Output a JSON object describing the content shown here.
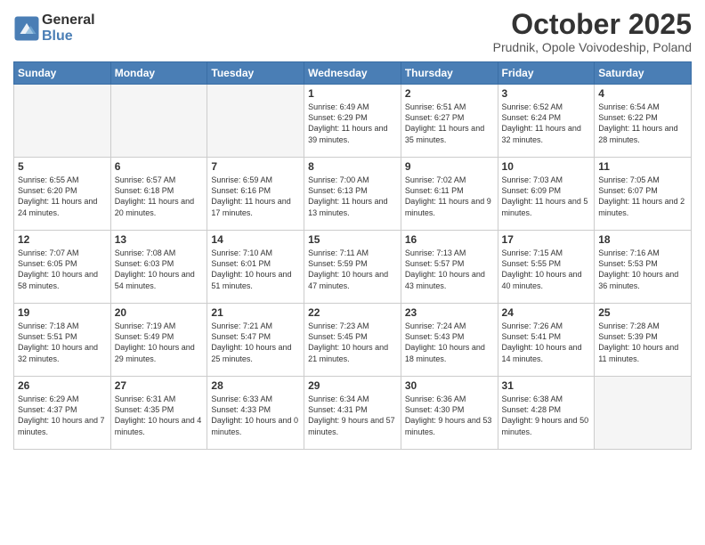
{
  "header": {
    "logo_general": "General",
    "logo_blue": "Blue",
    "month": "October 2025",
    "location": "Prudnik, Opole Voivodeship, Poland"
  },
  "weekdays": [
    "Sunday",
    "Monday",
    "Tuesday",
    "Wednesday",
    "Thursday",
    "Friday",
    "Saturday"
  ],
  "weeks": [
    [
      {
        "day": "",
        "info": ""
      },
      {
        "day": "",
        "info": ""
      },
      {
        "day": "",
        "info": ""
      },
      {
        "day": "1",
        "info": "Sunrise: 6:49 AM\nSunset: 6:29 PM\nDaylight: 11 hours\nand 39 minutes."
      },
      {
        "day": "2",
        "info": "Sunrise: 6:51 AM\nSunset: 6:27 PM\nDaylight: 11 hours\nand 35 minutes."
      },
      {
        "day": "3",
        "info": "Sunrise: 6:52 AM\nSunset: 6:24 PM\nDaylight: 11 hours\nand 32 minutes."
      },
      {
        "day": "4",
        "info": "Sunrise: 6:54 AM\nSunset: 6:22 PM\nDaylight: 11 hours\nand 28 minutes."
      }
    ],
    [
      {
        "day": "5",
        "info": "Sunrise: 6:55 AM\nSunset: 6:20 PM\nDaylight: 11 hours\nand 24 minutes."
      },
      {
        "day": "6",
        "info": "Sunrise: 6:57 AM\nSunset: 6:18 PM\nDaylight: 11 hours\nand 20 minutes."
      },
      {
        "day": "7",
        "info": "Sunrise: 6:59 AM\nSunset: 6:16 PM\nDaylight: 11 hours\nand 17 minutes."
      },
      {
        "day": "8",
        "info": "Sunrise: 7:00 AM\nSunset: 6:13 PM\nDaylight: 11 hours\nand 13 minutes."
      },
      {
        "day": "9",
        "info": "Sunrise: 7:02 AM\nSunset: 6:11 PM\nDaylight: 11 hours\nand 9 minutes."
      },
      {
        "day": "10",
        "info": "Sunrise: 7:03 AM\nSunset: 6:09 PM\nDaylight: 11 hours\nand 5 minutes."
      },
      {
        "day": "11",
        "info": "Sunrise: 7:05 AM\nSunset: 6:07 PM\nDaylight: 11 hours\nand 2 minutes."
      }
    ],
    [
      {
        "day": "12",
        "info": "Sunrise: 7:07 AM\nSunset: 6:05 PM\nDaylight: 10 hours\nand 58 minutes."
      },
      {
        "day": "13",
        "info": "Sunrise: 7:08 AM\nSunset: 6:03 PM\nDaylight: 10 hours\nand 54 minutes."
      },
      {
        "day": "14",
        "info": "Sunrise: 7:10 AM\nSunset: 6:01 PM\nDaylight: 10 hours\nand 51 minutes."
      },
      {
        "day": "15",
        "info": "Sunrise: 7:11 AM\nSunset: 5:59 PM\nDaylight: 10 hours\nand 47 minutes."
      },
      {
        "day": "16",
        "info": "Sunrise: 7:13 AM\nSunset: 5:57 PM\nDaylight: 10 hours\nand 43 minutes."
      },
      {
        "day": "17",
        "info": "Sunrise: 7:15 AM\nSunset: 5:55 PM\nDaylight: 10 hours\nand 40 minutes."
      },
      {
        "day": "18",
        "info": "Sunrise: 7:16 AM\nSunset: 5:53 PM\nDaylight: 10 hours\nand 36 minutes."
      }
    ],
    [
      {
        "day": "19",
        "info": "Sunrise: 7:18 AM\nSunset: 5:51 PM\nDaylight: 10 hours\nand 32 minutes."
      },
      {
        "day": "20",
        "info": "Sunrise: 7:19 AM\nSunset: 5:49 PM\nDaylight: 10 hours\nand 29 minutes."
      },
      {
        "day": "21",
        "info": "Sunrise: 7:21 AM\nSunset: 5:47 PM\nDaylight: 10 hours\nand 25 minutes."
      },
      {
        "day": "22",
        "info": "Sunrise: 7:23 AM\nSunset: 5:45 PM\nDaylight: 10 hours\nand 21 minutes."
      },
      {
        "day": "23",
        "info": "Sunrise: 7:24 AM\nSunset: 5:43 PM\nDaylight: 10 hours\nand 18 minutes."
      },
      {
        "day": "24",
        "info": "Sunrise: 7:26 AM\nSunset: 5:41 PM\nDaylight: 10 hours\nand 14 minutes."
      },
      {
        "day": "25",
        "info": "Sunrise: 7:28 AM\nSunset: 5:39 PM\nDaylight: 10 hours\nand 11 minutes."
      }
    ],
    [
      {
        "day": "26",
        "info": "Sunrise: 6:29 AM\nSunset: 4:37 PM\nDaylight: 10 hours\nand 7 minutes."
      },
      {
        "day": "27",
        "info": "Sunrise: 6:31 AM\nSunset: 4:35 PM\nDaylight: 10 hours\nand 4 minutes."
      },
      {
        "day": "28",
        "info": "Sunrise: 6:33 AM\nSunset: 4:33 PM\nDaylight: 10 hours\nand 0 minutes."
      },
      {
        "day": "29",
        "info": "Sunrise: 6:34 AM\nSunset: 4:31 PM\nDaylight: 9 hours\nand 57 minutes."
      },
      {
        "day": "30",
        "info": "Sunrise: 6:36 AM\nSunset: 4:30 PM\nDaylight: 9 hours\nand 53 minutes."
      },
      {
        "day": "31",
        "info": "Sunrise: 6:38 AM\nSunset: 4:28 PM\nDaylight: 9 hours\nand 50 minutes."
      },
      {
        "day": "",
        "info": ""
      }
    ]
  ]
}
